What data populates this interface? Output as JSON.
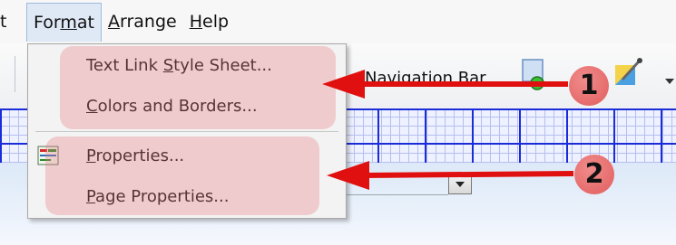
{
  "menubar": {
    "items": [
      {
        "label": "t",
        "underline": ""
      },
      {
        "pre": "For",
        "u": "m",
        "post": "at"
      },
      {
        "pre": "",
        "u": "A",
        "post": "rrange"
      },
      {
        "pre": "",
        "u": "H",
        "post": "elp"
      }
    ]
  },
  "toolbar": {
    "navigation_bar_label": "Navigation Bar"
  },
  "format_menu": {
    "items": [
      {
        "pre": "Text Link ",
        "u": "S",
        "post": "tyle Sheet..."
      },
      {
        "pre": "",
        "u": "C",
        "post": "olors and Borders..."
      },
      {
        "pre": "",
        "u": "P",
        "post": "roperties..."
      },
      {
        "pre": "",
        "u": "P",
        "post": "age Properties..."
      }
    ]
  },
  "callouts": [
    {
      "number": "1"
    },
    {
      "number": "2"
    }
  ],
  "colors": {
    "arrow": "#e01010",
    "highlight": "#eb7882",
    "grid_line": "#1a2bd8"
  }
}
